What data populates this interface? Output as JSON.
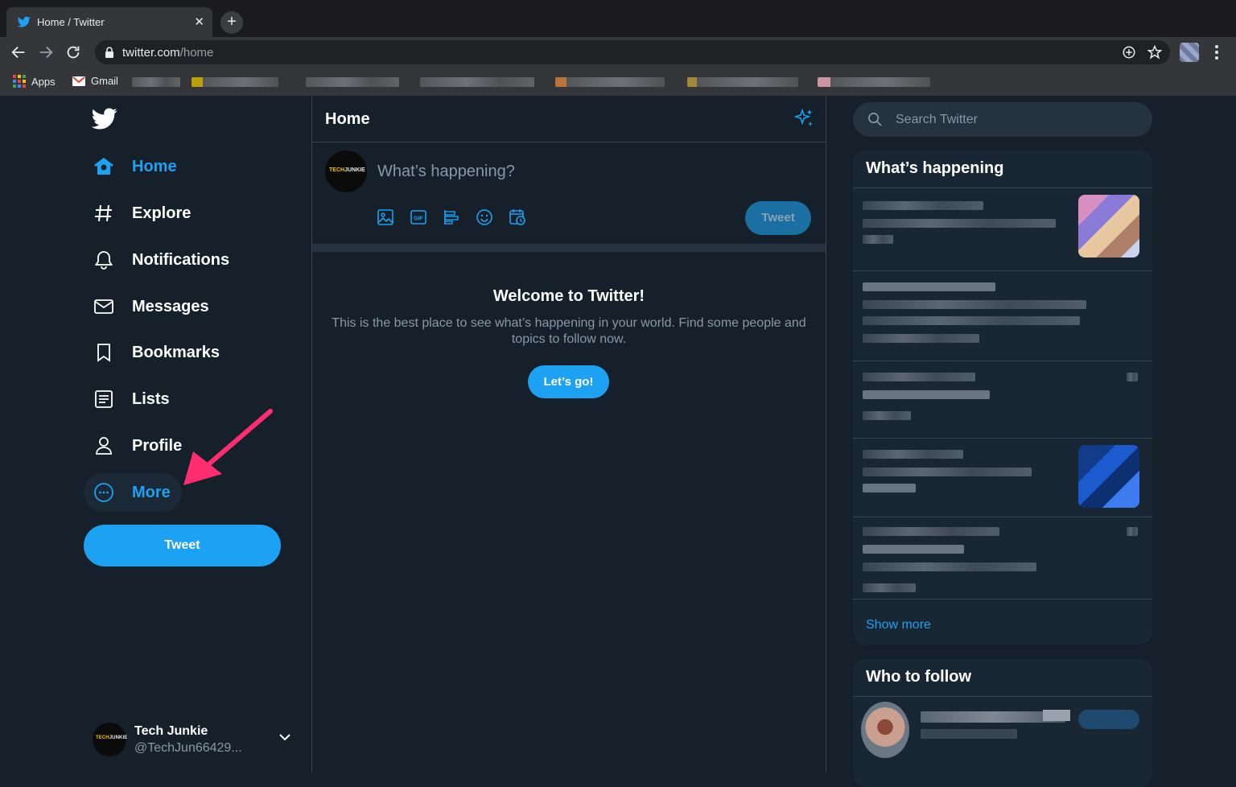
{
  "browser": {
    "tab_title": "Home / Twitter",
    "tab_close": "✕",
    "new_tab": "+",
    "url_host": "twitter.com",
    "url_path": "/home",
    "bookmarks": [
      {
        "label": "Apps"
      },
      {
        "label": "Gmail"
      }
    ]
  },
  "nav": {
    "items": [
      {
        "label": "Home",
        "icon": "home-icon"
      },
      {
        "label": "Explore",
        "icon": "hashtag-icon"
      },
      {
        "label": "Notifications",
        "icon": "bell-icon"
      },
      {
        "label": "Messages",
        "icon": "envelope-icon"
      },
      {
        "label": "Bookmarks",
        "icon": "bookmark-icon"
      },
      {
        "label": "Lists",
        "icon": "list-icon"
      },
      {
        "label": "Profile",
        "icon": "person-icon"
      },
      {
        "label": "More",
        "icon": "more-circle-icon"
      }
    ],
    "tweet_button": "Tweet"
  },
  "account": {
    "name": "Tech Junkie",
    "handle": "@TechJun66429...",
    "avatar_text_a": "TECH",
    "avatar_text_b": "JUNKIE"
  },
  "home": {
    "title": "Home",
    "composer_placeholder": "What’s happening?",
    "composer_tweet": "Tweet",
    "welcome_title": "Welcome to Twitter!",
    "welcome_text": "This is the best place to see what’s happening in your world. Find some people and topics to follow now.",
    "welcome_button": "Let’s go!"
  },
  "sidebar": {
    "search_placeholder": "Search Twitter",
    "happening_title": "What’s happening",
    "show_more": "Show more",
    "follow_title": "Who to follow"
  },
  "colors": {
    "background": "#15202b",
    "accent": "#1da1f2",
    "annotation_arrow": "#ff2d6f"
  }
}
